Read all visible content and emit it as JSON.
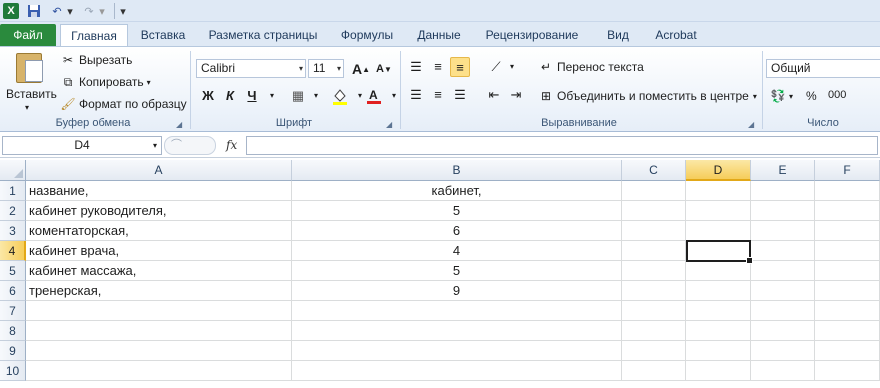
{
  "qat": {
    "logo": "X",
    "save": "💾",
    "undo": "↶",
    "redo": "↷",
    "dropdown": "▾"
  },
  "tabs": [
    "Файл",
    "Главная",
    "Вставка",
    "Разметка страницы",
    "Формулы",
    "Данные",
    "Рецензирование",
    "Вид",
    "Acrobat"
  ],
  "clipboard": {
    "paste": "Вставить",
    "cut": "Вырезать",
    "copy": "Копировать",
    "format_painter": "Формат по образцу",
    "group": "Буфер обмена"
  },
  "font": {
    "name": "Calibri",
    "size": "11",
    "bold": "Ж",
    "italic": "К",
    "underline": "Ч",
    "group": "Шрифт"
  },
  "alignment": {
    "wrap_text": "Перенос текста",
    "merge_center": "Объединить и поместить в центре",
    "group": "Выравнивание"
  },
  "number": {
    "format": "Общий",
    "percent": "%",
    "thousands": "000",
    "group": "Число"
  },
  "formula_bar": {
    "name_box": "D4",
    "fx": "fx",
    "value": ""
  },
  "colors": {
    "accent": "#2a8a3d",
    "selection": "#f6cd5a"
  },
  "columns": [
    "A",
    "B",
    "C",
    "D",
    "E",
    "F"
  ],
  "rows": [
    "1",
    "2",
    "3",
    "4",
    "5",
    "6",
    "7",
    "8",
    "9",
    "10"
  ],
  "cells": [
    {
      "a": "название,",
      "b": "кабинет,"
    },
    {
      "a": "кабинет руководителя,",
      "b": "5"
    },
    {
      "a": "коментаторская,",
      "b": "6"
    },
    {
      "a": "кабинет врача,",
      "b": "4"
    },
    {
      "a": "кабинет массажа,",
      "b": "5"
    },
    {
      "a": "тренерская,",
      "b": "9"
    }
  ]
}
